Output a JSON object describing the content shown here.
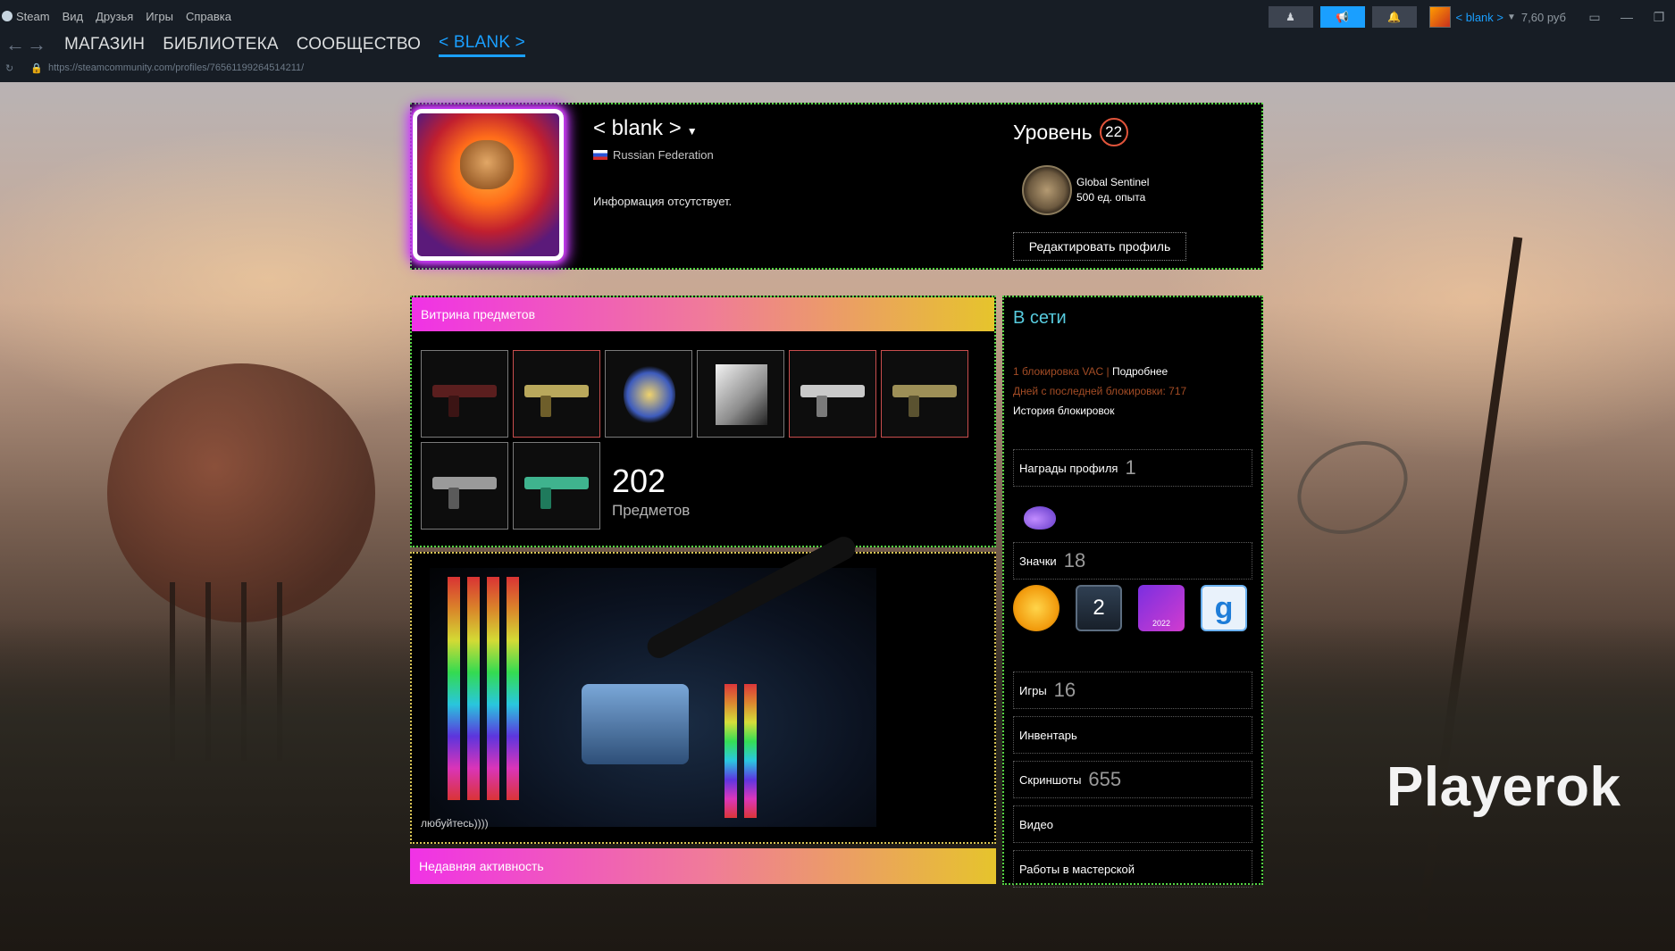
{
  "menu": [
    "Steam",
    "Вид",
    "Друзья",
    "Игры",
    "Справка"
  ],
  "nav": {
    "tabs": [
      "МАГАЗИН",
      "БИБЛИОТЕКА",
      "СООБЩЕСТВО",
      "< BLANK >"
    ],
    "url": "https://steamcommunity.com/profiles/76561199264514211/"
  },
  "account": {
    "name": "< blank >",
    "balance": "7,60 руб"
  },
  "profile": {
    "name": "< blank >",
    "country": "Russian Federation",
    "summary": "Информация отсутствует.",
    "level_label": "Уровень",
    "level": "22",
    "badge_name": "Global Sentinel",
    "badge_xp": "500 ед. опыта",
    "edit_button": "Редактировать профиль"
  },
  "showcase": {
    "title": "Витрина предметов",
    "count": "202",
    "count_label": "Предметов"
  },
  "artwork": {
    "caption": "любуйтесь))))"
  },
  "recent": {
    "title": "Недавняя активность"
  },
  "side": {
    "status": "В сети",
    "vac": "1 блокировка VAC",
    "vac_sep": " | ",
    "vac_more": "Подробнее",
    "days": "Дней с последней блокировки: 717",
    "history": "История блокировок",
    "awards_label": "Награды профиля",
    "awards_count": "1",
    "badges_label": "Значки",
    "badges_count": "18",
    "badge_year": "2022",
    "badge_two": "2",
    "badge_g": "g",
    "games_label": "Игры",
    "games_count": "16",
    "inventory_label": "Инвентарь",
    "screens_label": "Скриншоты",
    "screens_count": "655",
    "video_label": "Видео",
    "workshop_label": "Работы в мастерской"
  },
  "watermark": "Playerok",
  "colors": {
    "accent": "#1a9fff",
    "online": "#57cbde",
    "vac": "#a34c25",
    "panel_border": "#54d243"
  }
}
